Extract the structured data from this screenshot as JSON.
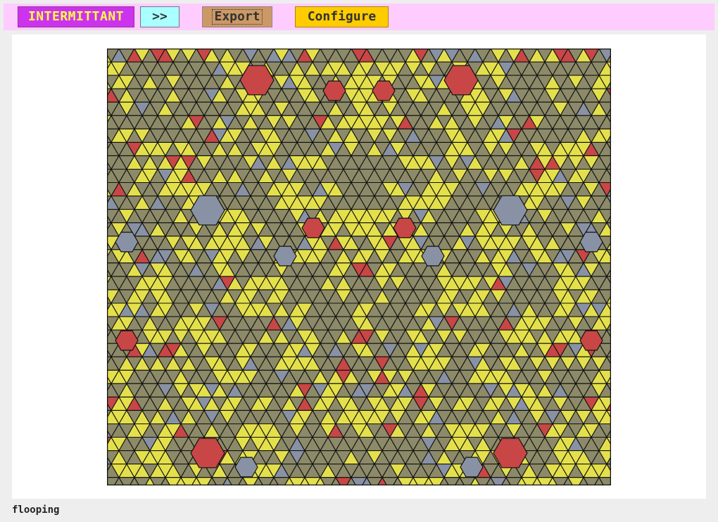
{
  "toolbar": {
    "mode_label": "INTERMITTANT",
    "next_label": ">>",
    "export_label": "Export",
    "configure_label": "Configure"
  },
  "canvas": {
    "palette": {
      "olive": "#8c8a68",
      "yellow": "#e4e04c",
      "red": "#c84646",
      "slate": "#8892a4",
      "stroke": "#111111"
    },
    "symmetry": "mirror-left-right"
  },
  "status": {
    "text": "flooping"
  }
}
